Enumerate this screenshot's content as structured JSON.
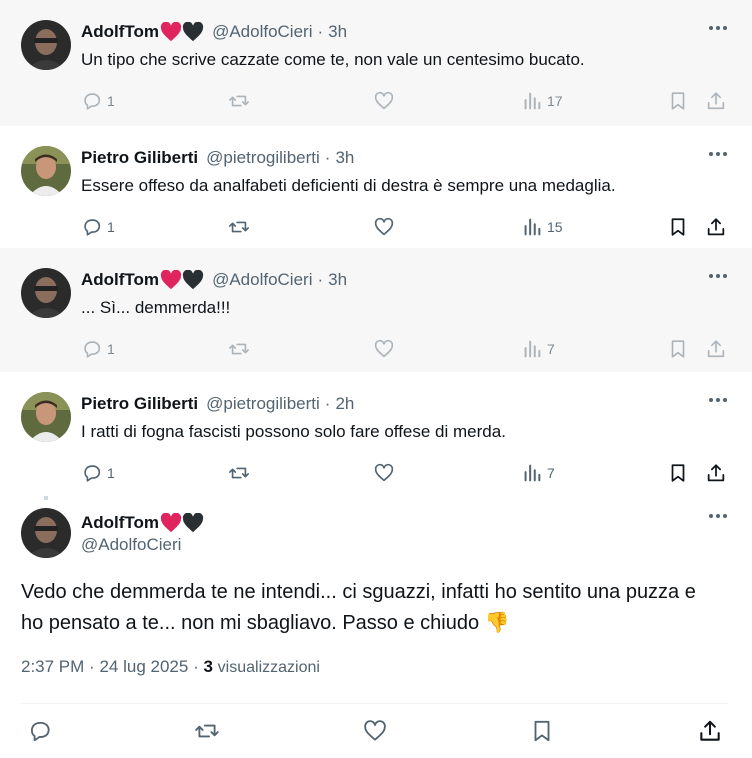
{
  "tweets": [
    {
      "name": "AdolfTom",
      "handle": "@AdolfoCieri",
      "time": "3h",
      "text": "Un tipo che scrive cazzate come te, non vale un centesimo bucato.",
      "replies": "1",
      "views": "17"
    },
    {
      "name": "Pietro Giliberti",
      "handle": "@pietrogiliberti",
      "time": "3h",
      "text": "Essere offeso da analfabeti deficienti di destra è sempre una medaglia.",
      "replies": "1",
      "views": "15"
    },
    {
      "name": "AdolfTom",
      "handle": "@AdolfoCieri",
      "time": "3h",
      "text": "... Sì... demmerda!!!",
      "replies": "1",
      "views": "7"
    },
    {
      "name": "Pietro Giliberti",
      "handle": "@pietrogiliberti",
      "time": "2h",
      "text": "I ratti di fogna fascisti possono solo fare offese di merda.",
      "replies": "1",
      "views": "7"
    }
  ],
  "main": {
    "name": "AdolfTom",
    "handle": "@AdolfoCieri",
    "text": "Vedo che demmerda te ne intendi... ci sguazzi, infatti ho sentito una puzza e ho pensato a te... non mi sbagliavo. Passo e chiudo",
    "time": "2:37 PM",
    "date": "24 lug 2025",
    "views": "3",
    "views_label": "visualizzazioni"
  },
  "sep": "·",
  "emoji": "👎",
  "colors": {
    "name": "#0f1419",
    "secondary": "#536471",
    "heart_red": "#e0245e",
    "heart_black": "#292f33",
    "thread_line": "#cfd9de",
    "dim_bg": "#f7f7f7"
  },
  "icons": [
    "reply-icon",
    "retweet-icon",
    "like-icon",
    "views-icon",
    "bookmark-icon",
    "share-icon",
    "more-icon",
    "red-heart-icon",
    "black-heart-icon",
    "thumbs-down-icon"
  ]
}
